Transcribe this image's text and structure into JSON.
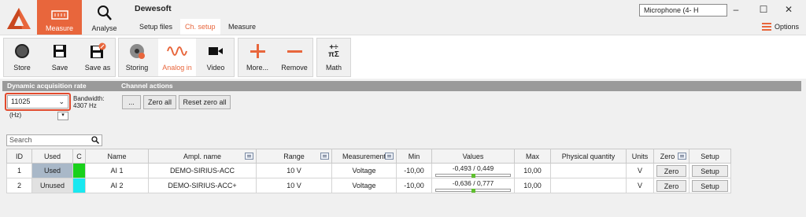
{
  "app": {
    "title": "Dewesoft"
  },
  "main_tabs": [
    {
      "label": "Measure",
      "active": true
    },
    {
      "label": "Analyse",
      "active": false
    }
  ],
  "sub_tabs": [
    {
      "label": "Setup files",
      "active": false
    },
    {
      "label": "Ch. setup",
      "active": true
    },
    {
      "label": "Measure",
      "active": false
    }
  ],
  "device_selector": {
    "value": "Microphone (4- H"
  },
  "window_controls": [
    "minimize",
    "maximize",
    "close"
  ],
  "options": {
    "label": "Options"
  },
  "toolbar": {
    "store": "Store",
    "save": "Save",
    "save_as": "Save as",
    "storing": "Storing",
    "analog_in": "Analog in",
    "video": "Video",
    "more": "More...",
    "remove": "Remove",
    "math": "Math"
  },
  "acquisition": {
    "header": "Dynamic acquisition rate",
    "rate_value": "11025",
    "bandwidth_label": "Bandwidth:",
    "bandwidth_value": "4307 Hz",
    "unit": "(Hz)"
  },
  "channel_actions": {
    "header": "Channel actions",
    "more_label": "...",
    "zero_all_label": "Zero all",
    "reset_zero_all_label": "Reset zero all"
  },
  "search": {
    "placeholder": "Search"
  },
  "table": {
    "columns": [
      "ID",
      "Used",
      "C",
      "Name",
      "Ampl. name",
      "Range",
      "Measurement",
      "Min",
      "Values",
      "Max",
      "Physical quantity",
      "Units",
      "Zero",
      "Setup"
    ],
    "rows": [
      {
        "id": "1",
        "used": "Used",
        "color": "#19d11b",
        "name": "AI 1",
        "ampl_name": "DEMO-SIRIUS-ACC",
        "range": "10 V",
        "measurement": "Voltage",
        "min": "-10,00",
        "values": "-0,493 / 0,449",
        "level": 0.5,
        "max": "10,00",
        "physical_quantity": "",
        "units": "V",
        "zero": "Zero",
        "setup": "Setup"
      },
      {
        "id": "2",
        "used": "Unused",
        "color": "#19e8f0",
        "name": "AI 2",
        "ampl_name": "DEMO-SIRIUS-ACC+",
        "range": "10 V",
        "measurement": "Voltage",
        "min": "-10,00",
        "values": "-0,636 / 0,777",
        "level": 0.5,
        "max": "10,00",
        "physical_quantity": "",
        "units": "V",
        "zero": "Zero",
        "setup": "Setup"
      }
    ]
  },
  "colors": {
    "accent": "#e8663c",
    "highlight": "#e24a2d",
    "band": "#9a9a9a"
  }
}
